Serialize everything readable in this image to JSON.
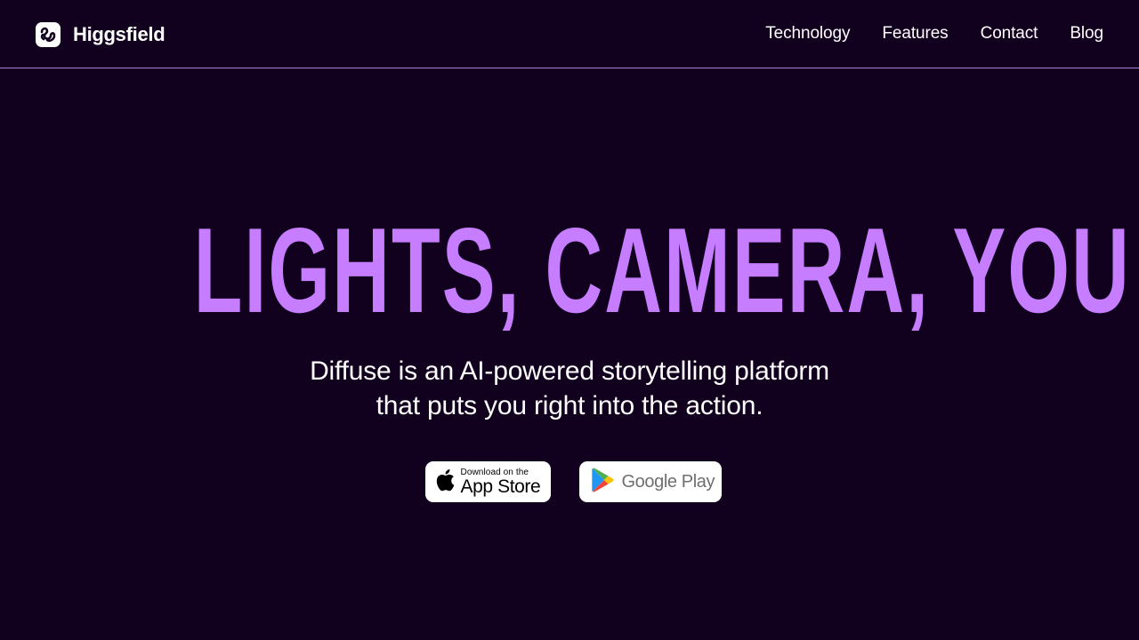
{
  "header": {
    "brand_name": "Higgsfield",
    "logo_icon": "higgsfield-wave-logo",
    "nav": [
      {
        "label": "Technology"
      },
      {
        "label": "Features"
      },
      {
        "label": "Contact"
      },
      {
        "label": "Blog"
      }
    ]
  },
  "hero": {
    "title": "LIGHTS, CAMERA, YOU",
    "subtitle_line1": "Diffuse is an AI-powered storytelling platform",
    "subtitle_line2": "that puts you right into the action."
  },
  "stores": {
    "apple": {
      "icon": "apple-icon",
      "small_label": "Download on the",
      "big_label": "App Store"
    },
    "google": {
      "icon": "google-play-icon",
      "label": "Google Play"
    }
  },
  "colors": {
    "background": "#12001F",
    "accent": "#C77DFF",
    "divider": "#B07CE0",
    "text": "#FFFFFF"
  }
}
